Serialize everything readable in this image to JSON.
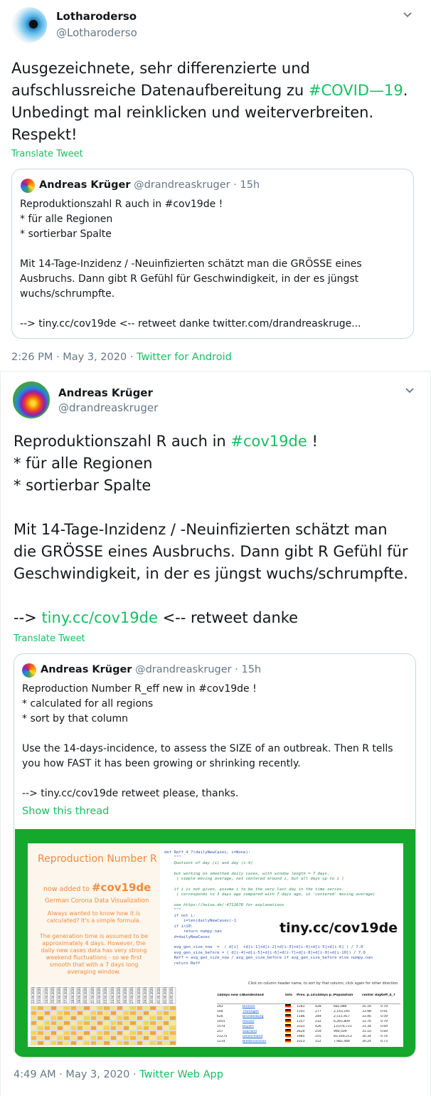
{
  "tweet1": {
    "author_name": "Lotharoderso",
    "author_handle": "@Lotharoderso",
    "text_line1": "Ausgezeichnete, sehr differenzierte und",
    "text_line2_pre": "aufschlussreiche Datenaufbereitung zu ",
    "hashtag": "#COVID—19",
    "text_line2_post": ".",
    "text_line3": "Unbedingt mal reinklicken und weiterverbreiten.",
    "text_line4": "Respekt!",
    "translate": "Translate Tweet",
    "quote": {
      "name": "Andreas Krüger",
      "handle": "@drandreaskruger",
      "time": "· 15h",
      "lines": [
        "Reproduktionszahl R auch in #cov19de !",
        "* für alle Regionen",
        "* sortierbar Spalte",
        "",
        "Mit 14-Tage-Inzidenz / -Neuinfizierten schätzt man die GRÖSSE eines",
        "Ausbruchs. Dann gibt R Gefühl für Geschwindigkeit, in der es jüngst",
        "wuchs/schrumpfte.",
        "",
        "--> tiny.cc/cov19de <-- retweet danke twitter.com/drandreaskruge..."
      ]
    },
    "timestamp": "2:26 PM · May 3, 2020 ·",
    "app": "Twitter for Android"
  },
  "tweet2": {
    "author_name": "Andreas Krüger",
    "author_handle": "@drandreaskruger",
    "line1_pre": "Reproduktionszahl R auch in ",
    "line1_tag": "#cov19de",
    "line1_post": " !",
    "line2": "* für alle Regionen",
    "line3": "* sortierbar Spalte",
    "line4": "Mit 14-Tage-Inzidenz / -Neuinfizierten schätzt man",
    "line5": "die GRÖSSE eines Ausbruchs. Dann gibt R Gefühl für",
    "line6": "Geschwindigkeit, in der es jüngst wuchs/schrumpfte.",
    "line7_pre": "--> ",
    "line7_link": "tiny.cc/cov19de",
    "line7_post": " <-- retweet danke",
    "translate": "Translate Tweet",
    "quote": {
      "name": "Andreas Krüger",
      "handle": "@drandreaskruger",
      "time": "· 15h",
      "lines": [
        "Reproduction Number R_eff new in #cov19de !",
        "* calculated for all regions",
        "* sort by that column",
        "",
        "Use the 14-days-incidence, to assess the SIZE of an outbreak. Then R tells",
        "you how FAST it has been growing or shrinking recently.",
        "",
        "--> tiny.cc/cov19de retweet please, thanks."
      ],
      "show_thread": "Show this thread"
    },
    "media": {
      "title": "Reproduction Number R",
      "added_pre": "now added to ",
      "added_tag": "#cov19de",
      "subtitle": "German Corona Data Visualization",
      "para1": "Always wanted to know how it is calculated? It's a simple formula.",
      "para2": "The generation time is assumed to be approximately 4 days. However, the daily new cases data has very strong weekend fluctuations - so we first smooth that with a 7 days long averaging window.",
      "url": "tiny.cc/cov19de",
      "click_hint": "Click on column header name, to sort by that column; click again for other direction.",
      "code": [
        "def Reff_4_7(dailyNewCases, i=None):",
        "    \"\"\"",
        "    Quotient of day (i) and day (i-4)",
        "",
        "    but working on smoothed daily cases, with window length = 7 days.",
        "     ( simple moving average, not centered around i, but all days up to i )",
        "",
        "    if i is not given, assume i to be the very last day in the time series.",
        "     ( corresponds to 3 days ago compared with 7 days ago, in 'centered' moving average)",
        "",
        "    see https://heise.de/-4712676 for explanations",
        "    \"\"\"",
        "    if not i:",
        "        i=len(dailyNewCases)-1",
        "    if i<10:",
        "        return numpy.nan",
        "    d=dailyNewCases",
        "",
        "    avg_gen_size_now  =  ( d[i]  +d[i-1]+d[i-2]+d[i-3]+d[i-4]+d[i-5]+d[i-6] ) / 7.0",
        "    avg_gen_size_before = ( d[i-4]+d[i-5]+d[i-6]+d[i-7]+d[i-8]+d[i-9]+d[i-10]) / 7.0",
        "    Reff = avg_gen_size_now / avg_gen_size_before if avg_gen_size_before else numpy.nan",
        "    return Reff"
      ],
      "date_columns": [
        "12.04.2020",
        "13.04.2020",
        "14.04.2020",
        "15.04.2020",
        "16.04.2020",
        "17.04.2020",
        "18.04.2020",
        "19.04.2020",
        "20.04.2020",
        "21.04.2020",
        "22.04.2020",
        "23.04.2020",
        "24.04.2020",
        "25.04.2020",
        "26.04.2020",
        "27.04.2020",
        "28.04.2020",
        "29.04.2020",
        "30.04.2020",
        "01.05.2020",
        "02.05.2020",
        "03.05.2020"
      ],
      "table_headers": [
        "14days new cases",
        "Bundesland",
        "Info",
        "Prev. p.1mio",
        "14days p.1mio",
        "Population",
        "center day",
        "Reff_4_7"
      ],
      "rows": [
        [
          "293",
          "Bremen",
          "",
          "1281",
          "428",
          "682,986",
          "35.16",
          "0.79"
        ],
        [
          "594",
          "Thüringen",
          "",
          "1101",
          "277",
          "2,143,145",
          "33.98",
          "0.91"
        ],
        [
          "626",
          "Brandenburg",
          "",
          "1186",
          "249",
          "2,511,917",
          "33.46",
          "0.59"
        ],
        [
          "1455",
          "Hessen",
          "",
          "1357",
          "232",
          "6,265,809",
          "31.76",
          "0.79"
        ],
        [
          "5574",
          "Bayern",
          "",
          "3331",
          "426",
          "13,076,721",
          "31.34",
          "0.69"
        ],
        [
          "257",
          "Saarland",
          "",
          "2620",
          "259",
          "990,509",
          "31.10",
          "0.69"
        ],
        [
          "21275",
          "Deutschland",
          "",
          "1985",
          "255",
          "83,169,213",
          "30.34",
          "0.74"
        ],
        [
          "1214",
          "Niedersachsen",
          "",
          "1023",
          "152",
          "7,982,448",
          "30.24",
          "0.73"
        ]
      ]
    },
    "timestamp": "4:49 AM · May 3, 2020 ·",
    "app": "Twitter Web App"
  },
  "colors": {
    "accent": "#17bf63",
    "media_border": "#14a82c",
    "orange_text": "#f08a3c"
  }
}
